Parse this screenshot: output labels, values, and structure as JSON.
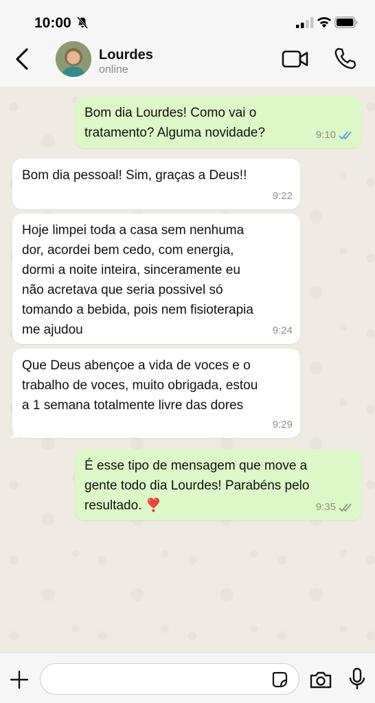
{
  "status_bar": {
    "time": "10:00"
  },
  "header": {
    "contact_name": "Lourdes",
    "contact_status": "online"
  },
  "messages": [
    {
      "direction": "out",
      "text": "Bom dia Lourdes! Como vai o\ntratamento? Alguma novidade?",
      "time": "9:10",
      "read": true
    },
    {
      "direction": "in",
      "text": "Bom dia pessoal! Sim, graças a Deus!!",
      "time": "9:22"
    },
    {
      "direction": "in",
      "text": "Hoje limpei toda a casa sem nenhuma\ndor, acordei bem cedo, com energia,\ndormi a noite inteira, sinceramente eu\nnão acretava que seria possivel só\ntomando a bebida, pois nem fisioterapia\nme ajudou",
      "time": "9:24"
    },
    {
      "direction": "in",
      "text": "Que Deus abençoe a vida de voces e o\ntrabalho de voces, muito obrigada, estou\na 1 semana totalmente livre das dores",
      "time": "9:29"
    },
    {
      "direction": "out",
      "text": "É esse tipo de mensagem que move a\ngente todo dia Lourdes! Parabéns pelo\nresultado. ❣️",
      "time": "9:35",
      "read": false
    }
  ],
  "input": {
    "placeholder": ""
  },
  "colors": {
    "outgoing_bubble": "#dcf8c6",
    "incoming_bubble": "#ffffff",
    "read_ticks": "#4fa3e0",
    "chat_background": "#efeae2"
  },
  "icons": {
    "back": "chevron-left-icon",
    "video": "video-camera-icon",
    "call": "phone-icon",
    "plus": "plus-icon",
    "sticker": "sticker-icon",
    "camera": "camera-icon",
    "mic": "microphone-icon",
    "mute": "bell-slash-icon",
    "signal": "signal-icon",
    "wifi": "wifi-icon",
    "battery": "battery-icon"
  }
}
